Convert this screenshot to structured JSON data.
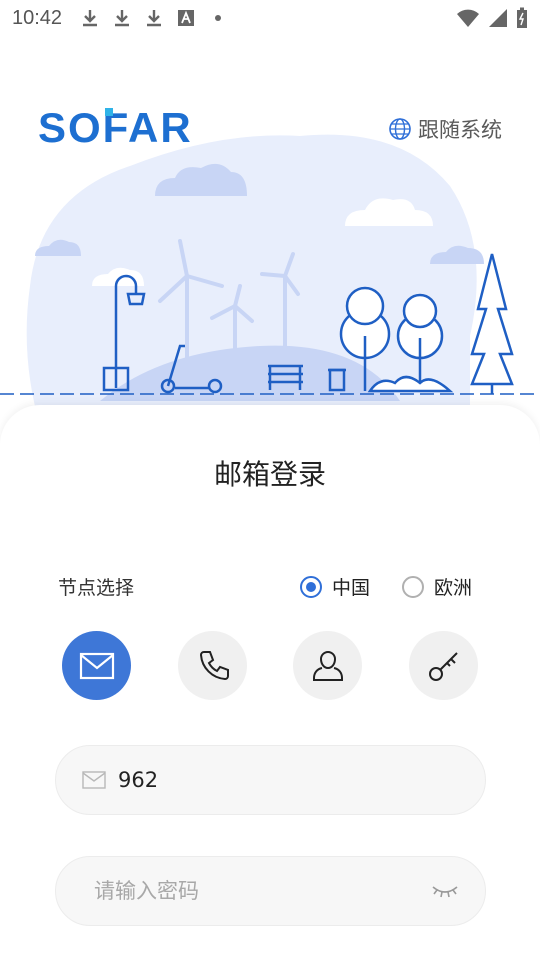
{
  "status_bar": {
    "time": "10:42",
    "left_icons": [
      "download-icon",
      "download-icon",
      "download-icon",
      "a-box-icon",
      "dot-icon"
    ],
    "right_icons": [
      "wifi-icon",
      "signal-icon",
      "battery-icon"
    ]
  },
  "header": {
    "logo_text": "SOFAR",
    "logo_color": "#1d6fd1",
    "logo_accent": "#2fb3e8",
    "language_label": "跟随系统",
    "language_icon": "globe-icon"
  },
  "login": {
    "title": "邮箱登录",
    "node_label": "节点选择",
    "node_options": [
      {
        "label": "中国",
        "checked": true
      },
      {
        "label": "欧洲",
        "checked": false
      }
    ],
    "methods": [
      {
        "name": "email",
        "icon": "mail-icon",
        "active": true
      },
      {
        "name": "phone",
        "icon": "phone-icon",
        "active": false
      },
      {
        "name": "account",
        "icon": "user-icon",
        "active": false
      },
      {
        "name": "key",
        "icon": "key-icon",
        "active": false
      }
    ],
    "email_value": "962",
    "password_placeholder": "请输入密码"
  },
  "colors": {
    "accent": "#3e77d7",
    "illustration_bg": "#e8eefc",
    "illustration_line": "#1f5fc4"
  }
}
